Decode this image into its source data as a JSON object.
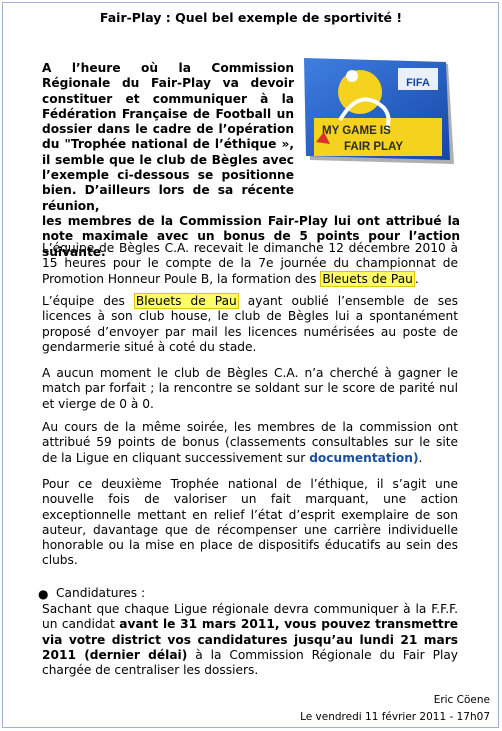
{
  "article": {
    "title": "Fair-Play : Quel bel exemple de sportivité !",
    "intro_narrow": "A l’heure où la Commission Régionale du Fair-Play va devoir constituer et communiquer à la Fédération Française de Football un dossier dans le cadre de l’opération du \"Trophée national de l’éthique », il semble que le club de Bègles avec l’exemple ci-dessous se positionne bien. D’ailleurs lors de sa récente réunion,",
    "intro_full": "les membres de la Commission Fair-Play lui ont attribué la note maximale avec un bonus de 5 points pour l’action suivante.",
    "p2_text": "L’équipe de Bègles C.A. recevait le dimanche 12 décembre 2010 à 15 heures pour le compte de la 7e journée du championnat de Promotion Honneur Poule B, la formation des ",
    "p2_highlight": "Bleuets de Pau",
    "p2_end": ".",
    "p3_start": "L’équipe des ",
    "p3_highlight": "Bleuets de Pau",
    "p3_text": " ayant oublié l’ensemble de ses licences à son club house, le club de Bègles lui a spontanément proposé d’envoyer par mail les licences numérisées au poste de gendarmerie situé à coté du stade.",
    "p4": "A aucun moment le club de Bègles C.A. n’a cherché à gagner le match par forfait ; la rencontre se soldant sur le score de parité nul et vierge de 0 à 0.",
    "p5_text": "Au cours de la même soirée, les membres de la commission ont attribué 59 points de bonus (classements consultables sur le site de la Ligue en cliquant successivement sur ",
    "p5_link": "documentation)",
    "p5_end": ".",
    "p6": "Pour ce deuxième Trophée national de l’éthique, il s’agit une nouvelle fois de valoriser un fait marquant, une action exceptionnelle mettant en relief l’état d’esprit exemplaire de son auteur, davantage que de récompenser une carrière individuelle honorable ou la mise en place de dispositifs éducatifs au sein des clubs.",
    "candidatures_label": "Candidatures :",
    "p7_start": "Sachant que chaque Ligue régionale devra communiquer à la F.F.F. un candidat ",
    "p7_bold": "avant le 31 mars 2011, vous pouvez transmettre via votre district vos candidatures jusqu’au lundi 21 mars 2011 (dernier délai)",
    "p7_end": " à la Commission Régionale du Fair Play chargée de centraliser les dossiers.",
    "author": "Eric Cöene",
    "date": "Le vendredi 11 février 2011 - 17h07"
  },
  "logo": {
    "line1": "MY GAME IS",
    "line2": "FAIR PLAY",
    "brand": "FIFA",
    "colors": {
      "blue": "#1f5fc8",
      "yellow": "#f4d21e",
      "dark": "#2c2c2c"
    }
  }
}
